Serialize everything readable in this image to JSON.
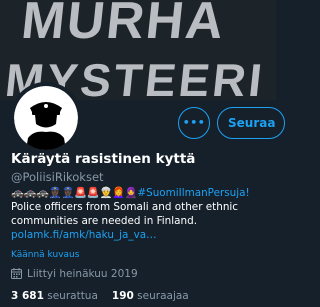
{
  "banner": {
    "text_line1": "MURHA",
    "text_line2": "MYSTEERI"
  },
  "actions": {
    "more_label": "•••",
    "follow_label": "Seuraa"
  },
  "profile": {
    "name": "Käräytä rasistinen kyttä",
    "handle": "@PoliisiRikokset",
    "bio_emojis": "🚓🚓🚓👮🏿👮🏿🚨🚨👳👩‍🦰🧕",
    "bio_hashtag": "#SuomiIlmanPersuja!",
    "bio_text": "Police officers from Somali and other ethnic communities are needed in Finland.",
    "bio_link": "polamk.fi/amk/haku_ja_va…",
    "translate_label": "Käännä kuvaus",
    "joined": "Liittyi heinäkuu 2019"
  },
  "stats": {
    "following_count": "3 681",
    "following_label": "seurattua",
    "followers_count": "190",
    "followers_label": "seuraajaa"
  },
  "colors": {
    "background": "#15202b",
    "accent": "#1da1f2",
    "muted": "#8899a6"
  },
  "icons": {
    "more": "more-dots-icon",
    "calendar": "calendar-icon"
  }
}
